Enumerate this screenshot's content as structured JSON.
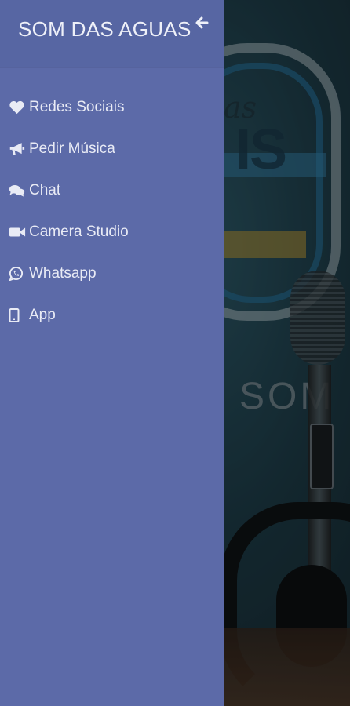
{
  "app": {
    "drawer_title": "SOM DAS AGUAS",
    "background_wordmark": "SOM"
  },
  "menu": {
    "items": [
      {
        "label": "Redes Sociais",
        "icon": "heart-icon"
      },
      {
        "label": "Pedir Música",
        "icon": "megaphone-icon"
      },
      {
        "label": "Chat",
        "icon": "chat-bubbles-icon"
      },
      {
        "label": "Camera Studio",
        "icon": "video-camera-icon"
      },
      {
        "label": "Whatsapp",
        "icon": "whatsapp-icon"
      },
      {
        "label": "App",
        "icon": "tablet-icon"
      }
    ]
  },
  "colors": {
    "drawer_bg": "#5c6aa8",
    "header_bg": "#5766a3",
    "text": "#e9ebf5"
  }
}
